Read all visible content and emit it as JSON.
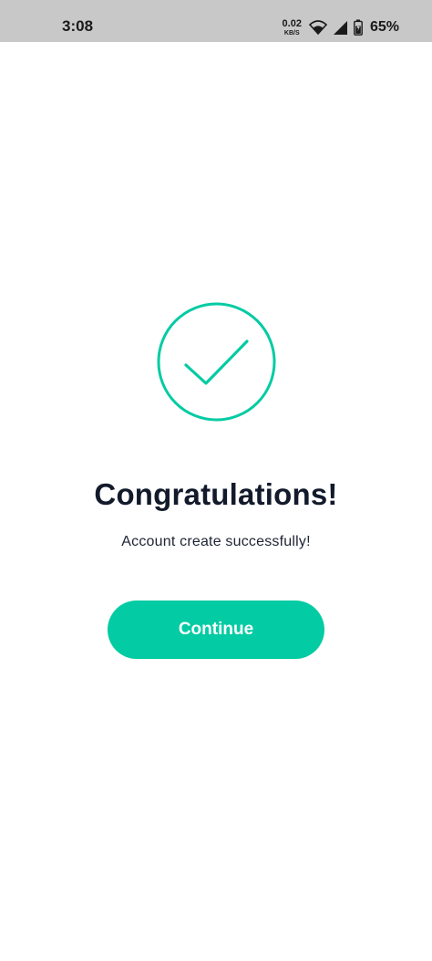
{
  "status_bar": {
    "time": "3:08",
    "net_speed_value": "0.02",
    "net_speed_unit": "KB/S",
    "battery_percent": "65%",
    "icons": [
      "wifi-icon",
      "signal-icon",
      "battery-icon"
    ]
  },
  "success": {
    "icon": "checkmark-circle-icon",
    "title": "Congratulations!",
    "message": "Account create successfully!",
    "button_label": "Continue"
  },
  "colors": {
    "accent": "#03cba3",
    "status_bar_bg": "#c8c8c8",
    "title_text": "#121a2b",
    "background": "#ffffff"
  }
}
